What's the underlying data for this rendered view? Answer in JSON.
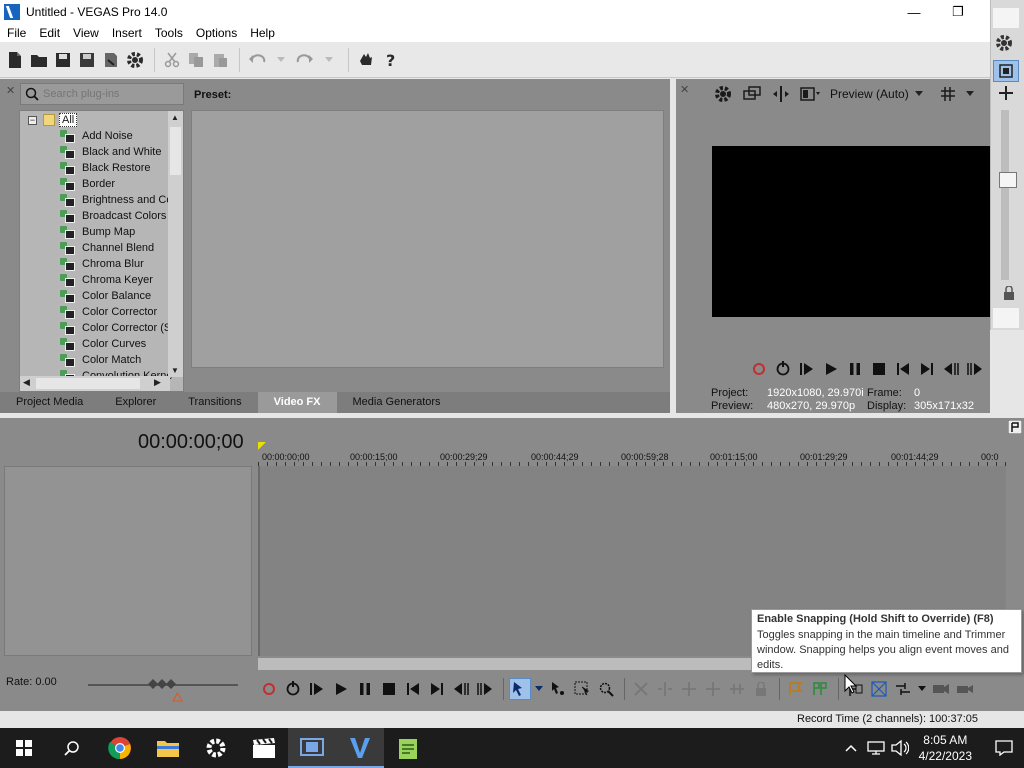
{
  "window": {
    "title": "Untitled - VEGAS Pro 14.0",
    "minimize": "—",
    "restore": "❐",
    "close": "✕"
  },
  "menu": [
    "File",
    "Edit",
    "View",
    "Insert",
    "Tools",
    "Options",
    "Help"
  ],
  "plugin_chooser": {
    "search_placeholder": "Search plug-ins",
    "preset_label": "Preset:",
    "root": "All",
    "items": [
      "Add Noise",
      "Black and White",
      "Black Restore",
      "Border",
      "Brightness and Co",
      "Broadcast Colors",
      "Bump Map",
      "Channel Blend",
      "Chroma Blur",
      "Chroma Keyer",
      "Color Balance",
      "Color Corrector",
      "Color Corrector (S",
      "Color Curves",
      "Color Match",
      "Convolution Kerne"
    ],
    "tabs": [
      "Project Media",
      "Explorer",
      "Transitions",
      "Video FX",
      "Media Generators"
    ],
    "active_tab": "Video FX"
  },
  "preview": {
    "mode": "Preview (Auto)",
    "project_label": "Project:",
    "project_value": "1920x1080, 29.970i",
    "preview_label": "Preview:",
    "preview_value": "480x270, 29.970p",
    "frame_label": "Frame:",
    "frame_value": "0",
    "display_label": "Display:",
    "display_value": "305x171x32"
  },
  "timeline": {
    "time": "00:00:00;00",
    "ruler": [
      "00:00:00;00",
      "00:00:15;00",
      "00:00:29;29",
      "00:00:44;29",
      "00:00:59;28",
      "00:01:15;00",
      "00:01:29;29",
      "00:01:44;29",
      "00:0"
    ],
    "rate": "Rate: 0.00"
  },
  "tooltip": {
    "title": "Enable Snapping (Hold Shift to Override) (F8)",
    "body": "Toggles snapping in the main timeline and Trimmer window. Snapping helps you align event moves and edits."
  },
  "status": {
    "record_time": "Record Time (2 channels): 100:37:05"
  },
  "taskbar": {
    "time": "8:05 AM",
    "date": "4/22/2023"
  }
}
